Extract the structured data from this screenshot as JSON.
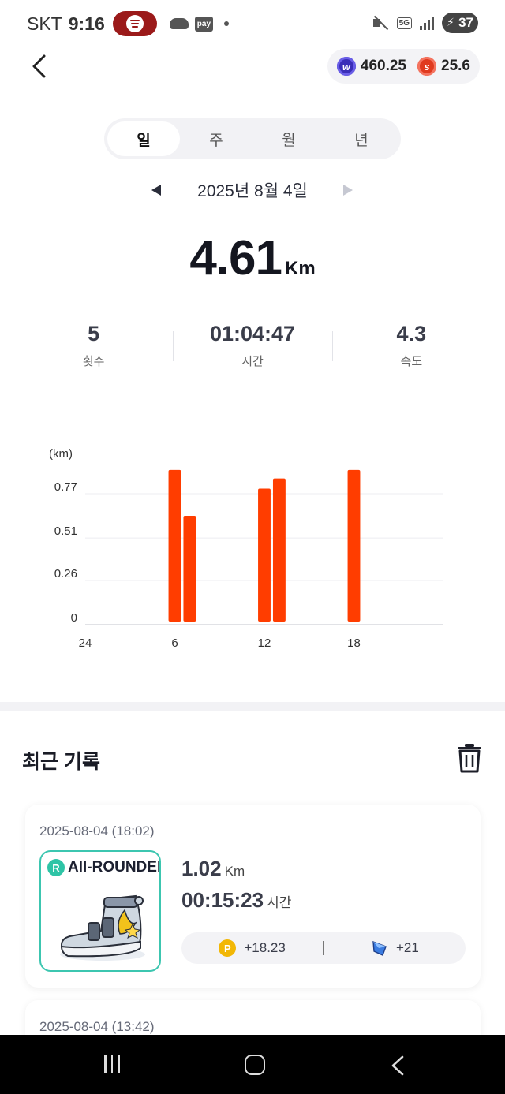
{
  "status_bar": {
    "carrier": "SKT",
    "time": "9:16",
    "pay_label": "pay",
    "network": "5G",
    "battery": "37"
  },
  "header": {
    "balance_w": "460.25",
    "balance_s": "25.6",
    "coin_w_letter": "w",
    "coin_s_letter": "s"
  },
  "tabs": [
    {
      "label": "일",
      "active": true
    },
    {
      "label": "주",
      "active": false
    },
    {
      "label": "월",
      "active": false
    },
    {
      "label": "년",
      "active": false
    }
  ],
  "date_nav": {
    "current_date": "2025년 8월 4일"
  },
  "summary": {
    "distance": "4.61",
    "distance_unit": "Km",
    "count_value": "5",
    "count_label": "횟수",
    "time_value": "01:04:47",
    "time_label": "시간",
    "speed_value": "4.3",
    "speed_label": "속도"
  },
  "chart_data": {
    "type": "bar",
    "ylabel": "(km)",
    "yticks": [
      0,
      0.26,
      0.51,
      0.77
    ],
    "ytick_labels": [
      "0",
      "0.26",
      "0.51",
      "0.77"
    ],
    "ylim": [
      0,
      0.9
    ],
    "xlim": [
      0,
      24
    ],
    "xtick_values": [
      0,
      6,
      12,
      18
    ],
    "xtick_labels": [
      "24",
      "6",
      "12",
      "18"
    ],
    "bar_color": "#ff3d00",
    "grid": true,
    "bars": [
      {
        "hour": 6,
        "value": 0.91
      },
      {
        "hour": 7,
        "value": 0.64
      },
      {
        "hour": 12,
        "value": 0.8
      },
      {
        "hour": 13,
        "value": 0.86
      },
      {
        "hour": 18,
        "value": 0.91
      }
    ]
  },
  "recent": {
    "title": "최근 기록",
    "records": [
      {
        "datetime": "2025-08-04 (18:02)",
        "shoe_badge": "R",
        "shoe_name": "All-ROUNDER",
        "distance": "1.02",
        "distance_unit": "Km",
        "duration": "00:15:23",
        "duration_unit": "시간",
        "points_letter": "P",
        "points": "+18.23",
        "gems": "+21"
      },
      {
        "datetime": "2025-08-04 (13:42)"
      }
    ]
  },
  "colors": {
    "accent_bar": "#ff3d00",
    "shoe_border": "#3cc6b0",
    "coin_w": "#3a2eb8",
    "coin_s": "#e03a1f",
    "coin_p": "#f2b705"
  },
  "icons": {
    "back": "chevron-left-icon",
    "trash": "trash-icon",
    "gem": "gem-icon"
  }
}
